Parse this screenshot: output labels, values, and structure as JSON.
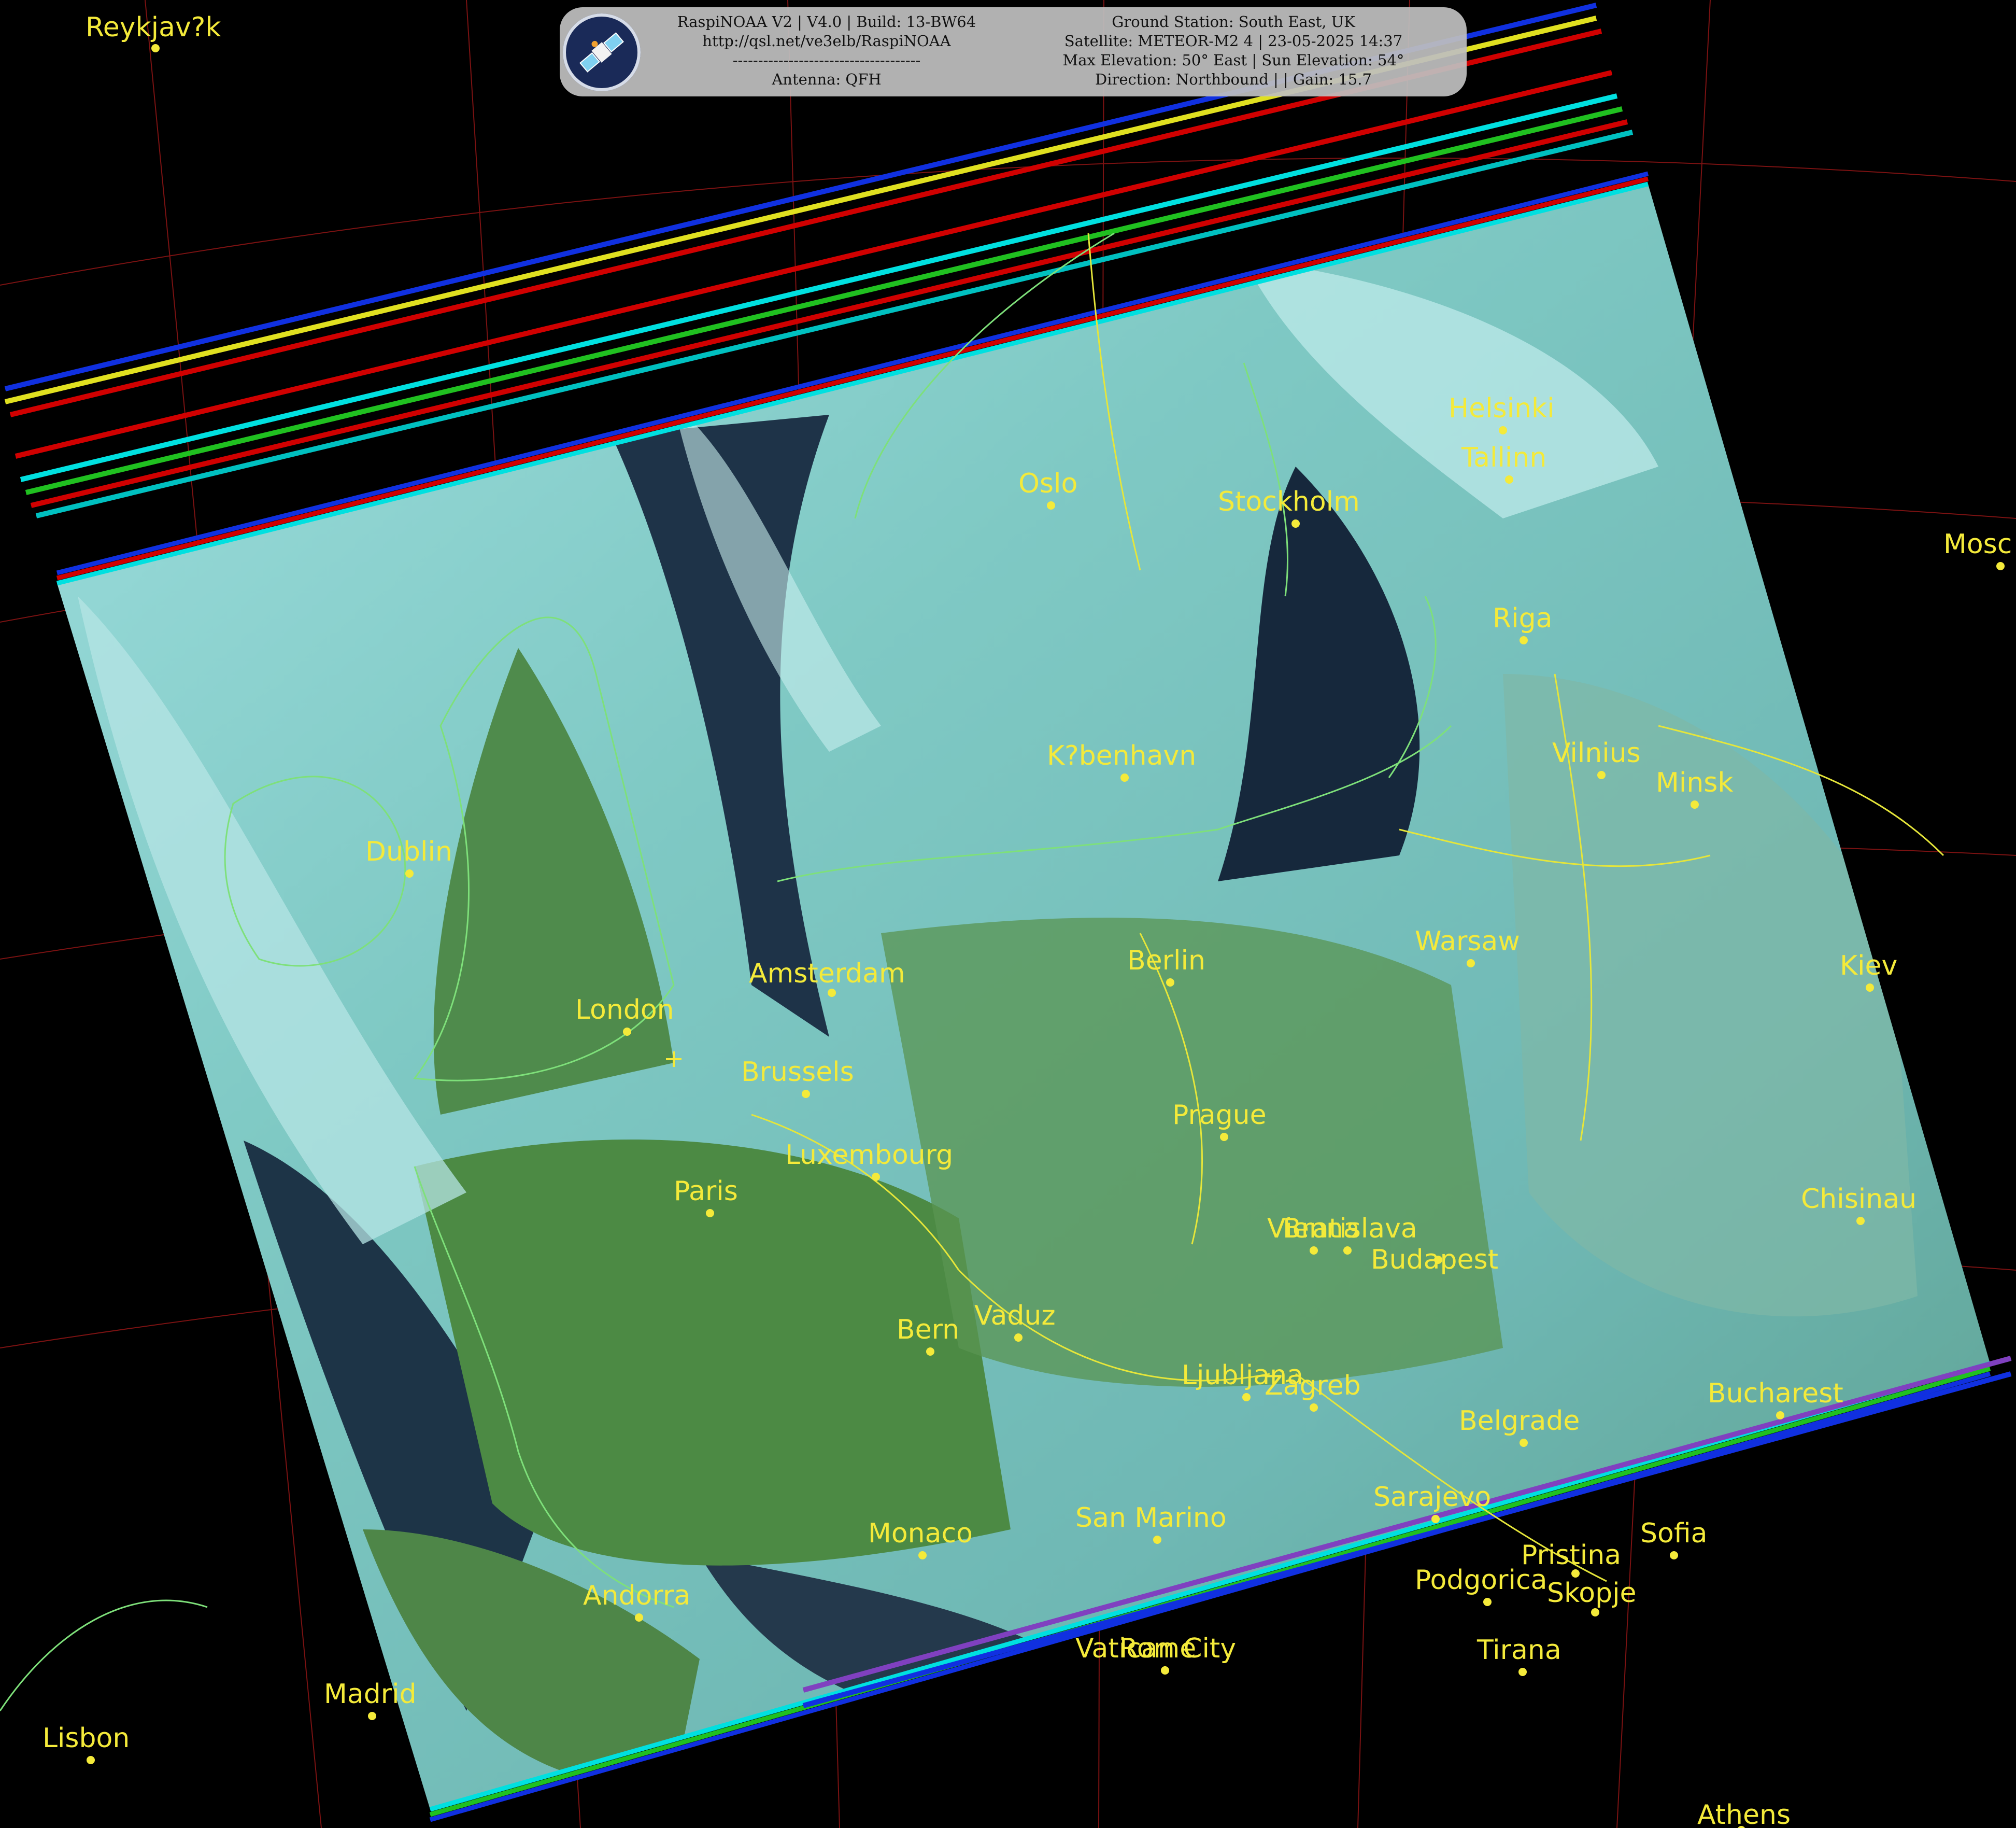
{
  "header": {
    "left_lines": [
      "RaspiNOAA V2 | V4.0 | Build: 13-BW64",
      "http://qsl.net/ve3elb/RaspiNOAA",
      "-------------------------------------",
      "Antenna: QFH"
    ],
    "right_lines": [
      "Ground Station: South East, UK",
      "Satellite: METEOR-M2 4 | 23-05-2025 14:37",
      "Max Elevation: 50° East | Sun Elevation: 54°",
      "Direction: Northbound | | Gain: 15.7"
    ],
    "logo_icon": "satellite-icon"
  },
  "colors": {
    "background": "#000000",
    "label": "#f4ea3a",
    "coastline": "#7ee07a",
    "border": "#e6e63a",
    "graticule": "#8a1414"
  },
  "cities": [
    {
      "name": "Reykjav?k"
    },
    {
      "name": "Dublin"
    },
    {
      "name": "London"
    },
    {
      "name": "Amsterdam"
    },
    {
      "name": "Brussels"
    },
    {
      "name": "Luxembourg"
    },
    {
      "name": "Paris"
    },
    {
      "name": "Oslo"
    },
    {
      "name": "Stockholm"
    },
    {
      "name": "Helsinki"
    },
    {
      "name": "Tallinn"
    },
    {
      "name": "Riga"
    },
    {
      "name": "Vilnius"
    },
    {
      "name": "Minsk"
    },
    {
      "name": "K?benhavn"
    },
    {
      "name": "Berlin"
    },
    {
      "name": "Warsaw"
    },
    {
      "name": "Prague"
    },
    {
      "name": "Kiev"
    },
    {
      "name": "Mosc"
    },
    {
      "name": "Vienna"
    },
    {
      "name": "Bratislava"
    },
    {
      "name": "Budapest"
    },
    {
      "name": "Chisinau"
    },
    {
      "name": "Bern"
    },
    {
      "name": "Vaduz"
    },
    {
      "name": "Ljubljana"
    },
    {
      "name": "Zagreb"
    },
    {
      "name": "Belgrade"
    },
    {
      "name": "Bucharest"
    },
    {
      "name": "Sarajevo"
    },
    {
      "name": "Sofia"
    },
    {
      "name": "Pristina"
    },
    {
      "name": "Podgorica"
    },
    {
      "name": "Skopje"
    },
    {
      "name": "Tirana"
    },
    {
      "name": "Monaco"
    },
    {
      "name": "San Marino"
    },
    {
      "name": "Vatican City"
    },
    {
      "name": "Rome"
    },
    {
      "name": "Andorra"
    },
    {
      "name": "Madrid"
    },
    {
      "name": "Lisbon"
    },
    {
      "name": "Athens"
    }
  ]
}
